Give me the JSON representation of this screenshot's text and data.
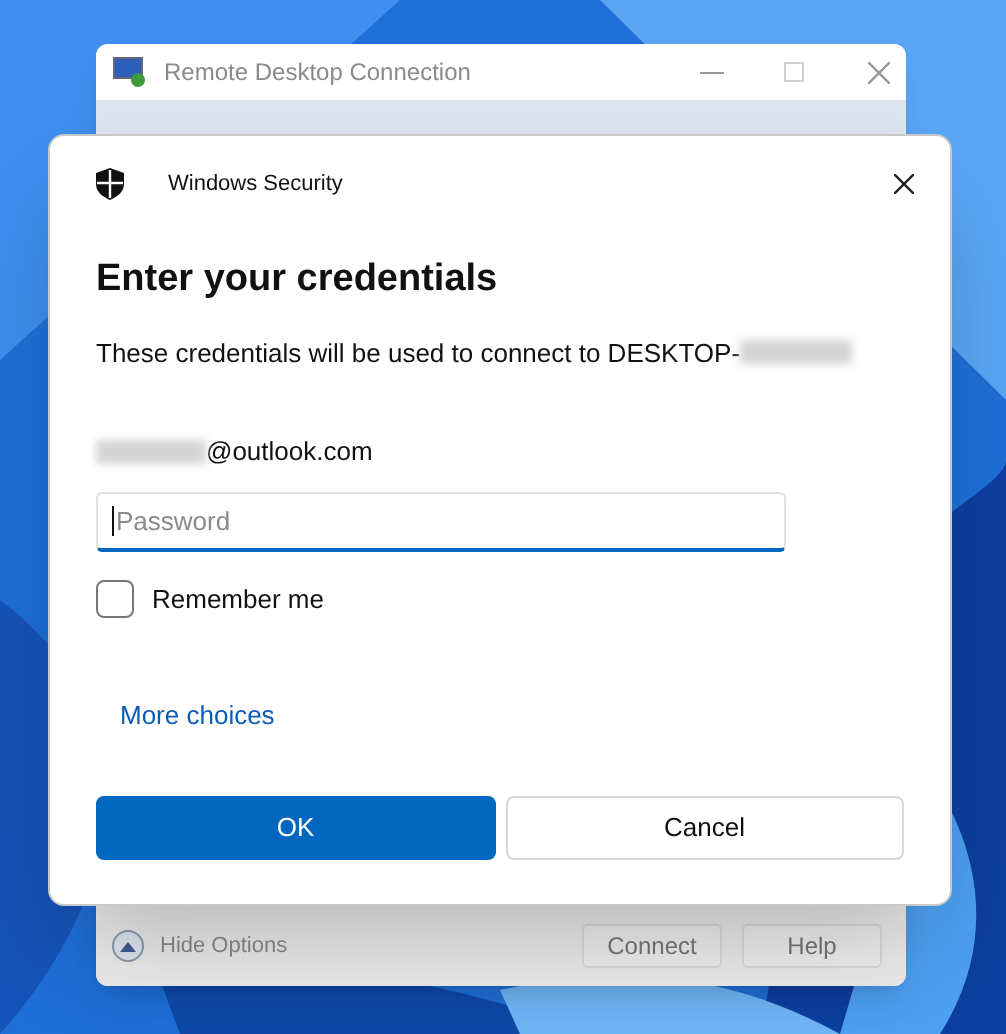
{
  "back_window": {
    "title": "Remote Desktop Connection",
    "active": false,
    "footer": {
      "toggle": "Hide Options",
      "buttons": [
        "Connect",
        "Help"
      ]
    }
  },
  "dialog": {
    "app": "Windows Security",
    "heading": "Enter your credentials",
    "message": "These credentials will be used to connect to DESKTOP-",
    "account": "@outlook.com",
    "password": {
      "placeholder": "Password",
      "focused": true
    },
    "remember": {
      "label": "Remember me",
      "checked": false
    },
    "more_link": "More choices",
    "buttons": [
      {
        "label": "OK",
        "primary": true
      },
      {
        "label": "Cancel",
        "primary": false
      }
    ]
  }
}
